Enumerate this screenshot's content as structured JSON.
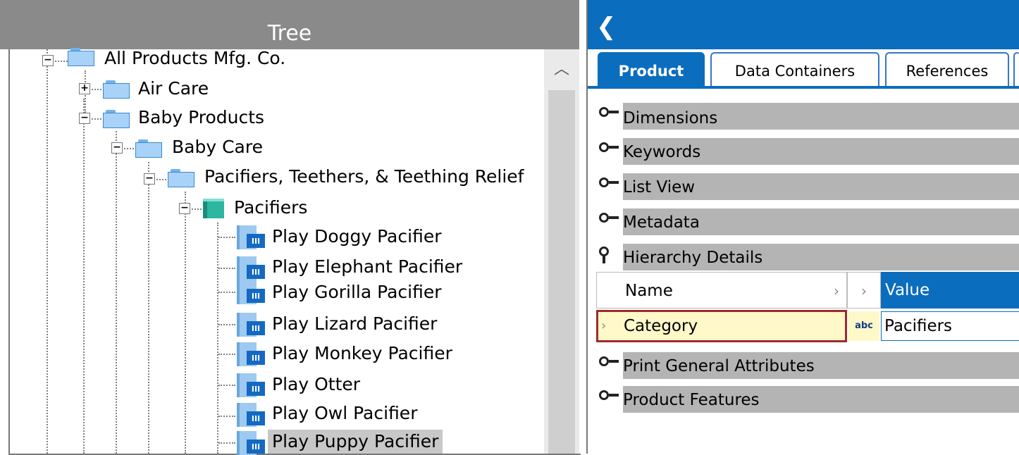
{
  "tree": {
    "title": "Tree",
    "nodes": [
      {
        "label": "All Products Mfg. Co.",
        "icon": "folder-icon",
        "expander": "minus"
      },
      {
        "label": "Air Care",
        "icon": "folder-icon",
        "expander": "plus"
      },
      {
        "label": "Baby Products",
        "icon": "folder-icon",
        "expander": "minus"
      },
      {
        "label": "Baby Care",
        "icon": "folder-icon",
        "expander": "minus"
      },
      {
        "label": "Pacifiers, Teethers, & Teething Relief",
        "icon": "folder-icon",
        "expander": "minus"
      },
      {
        "label": "Pacifiers",
        "icon": "category-cube-icon",
        "expander": "minus"
      },
      {
        "label": "Play Doggy Pacifier",
        "icon": "product-icon"
      },
      {
        "label": "Play Elephant Pacifier",
        "icon": "product-icon"
      },
      {
        "label": "Play Gorilla Pacifier",
        "icon": "product-icon"
      },
      {
        "label": "Play Lizard Pacifier",
        "icon": "product-icon"
      },
      {
        "label": "Play Monkey  Pacifier",
        "icon": "product-icon"
      },
      {
        "label": "Play Otter",
        "icon": "product-icon"
      },
      {
        "label": "Play Owl Pacifier",
        "icon": "product-icon"
      },
      {
        "label": "Play Puppy Pacifier",
        "icon": "product-icon",
        "selected": true
      }
    ],
    "product_icon_text": "III"
  },
  "detail": {
    "tabs": [
      {
        "label": "Product",
        "active": true
      },
      {
        "label": "Data Containers"
      },
      {
        "label": "References"
      }
    ],
    "sections": [
      {
        "label": "Dimensions",
        "expanded": false
      },
      {
        "label": "Keywords",
        "expanded": false
      },
      {
        "label": "List View",
        "expanded": false
      },
      {
        "label": "Metadata",
        "expanded": false
      },
      {
        "label": "Hierarchy Details",
        "expanded": true
      },
      {
        "label": "Print General Attributes",
        "expanded": false
      },
      {
        "label": "Product Features",
        "expanded": false
      }
    ],
    "grid": {
      "headers": {
        "name": "Name",
        "value": "Value"
      },
      "row": {
        "name": "Category",
        "type_badge": "abc",
        "value": "Pacifiers"
      }
    }
  },
  "colors": {
    "accent_blue": "#0b6dbd",
    "tree_header_gray": "#8a8a8a",
    "section_gray": "#b4b4b4",
    "selection_border": "#a1292a",
    "selection_fill": "#fff8c8"
  }
}
